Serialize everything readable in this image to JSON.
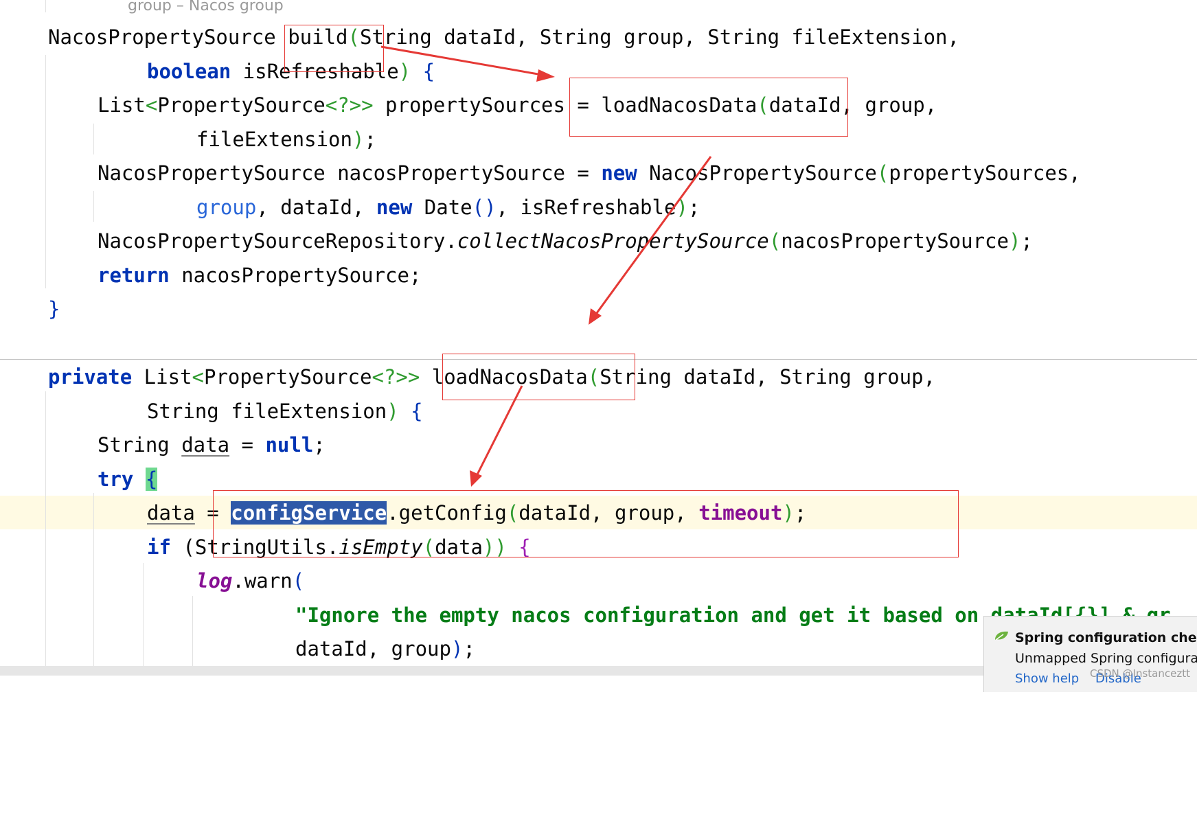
{
  "editor": {
    "hint": "group – Nacos group",
    "m1": {
      "l1a": "NacosPropertySource ",
      "l1b": "build",
      "l1c": "(",
      "l1d": "String dataId, String group, String fileExtension,",
      "l2a": "boolean",
      "l2b": " isRefreshable",
      "l2c": ")",
      "l2d": " {",
      "l3a": "List",
      "l3b": "<",
      "l3c": "PropertySource",
      "l3d": "<?>>",
      "l3e": " propertySources = loadNacosData",
      "l3f": "(",
      "l3g": "dataId, group,",
      "l4a": "fileExtension",
      "l4b": ")",
      "l4c": ";",
      "l5a": "NacosPropertySource nacosPropertySource = ",
      "l5b": "new",
      "l5c": " NacosPropertySource",
      "l5d": "(",
      "l5e": "propertySources,",
      "l6a": "group",
      "l6b": ", dataId, ",
      "l6c": "new",
      "l6d": " Date",
      "l6e": "()",
      "l6f": ", isRefreshable",
      "l6g": ")",
      "l6h": ";",
      "l7a": "NacosPropertySourceRepository.",
      "l7b": "collectNacosPropertySource",
      "l7c": "(",
      "l7d": "nacosPropertySource",
      "l7e": ")",
      "l7f": ";",
      "l8a": "return",
      "l8b": " nacosPropertySource;",
      "l9a": "}"
    },
    "m2": {
      "l1a": "private",
      "l1b": " List",
      "l1c": "<",
      "l1d": "PropertySource",
      "l1e": "<?>>",
      "l1f": " loadNacosData",
      "l1g": "(",
      "l1h": "String dataId, String group,",
      "l2a": "String fileExtension",
      "l2b": ")",
      "l2c": " {",
      "l3a": "String ",
      "l3b": "data",
      "l3c": " = ",
      "l3d": "null",
      "l3e": ";",
      "l4a": "try",
      "l4b": " ",
      "l4c": "{",
      "l5a": "data",
      "l5b": " = ",
      "l5c": "configService",
      "l5d": ".getConfig",
      "l5e": "(",
      "l5f": "dataId, group, ",
      "l5g": "timeout",
      "l5h": ")",
      "l5i": ";",
      "l6a": "if",
      "l6b": " ",
      "l6c": "(",
      "l6d": "StringUtils.",
      "l6e": "isEmpty",
      "l6f": "(",
      "l6g": "data",
      "l6h": "))",
      "l6i": " {",
      "l7a": "log",
      "l7b": ".warn",
      "l7c": "(",
      "l8a": "\"Ignore the empty nacos configuration and get it based on dataId[{}] & gr",
      "l9a": "dataId, group",
      "l9b": ")",
      "l9c": ";"
    }
  },
  "notification": {
    "title": "Spring configuration check",
    "message": "Unmapped Spring configuratio",
    "show_help": "Show help",
    "disable": "Disable",
    "icon": "spring-leaf-icon"
  },
  "watermark": "CSDN @Instanceztt",
  "colors": {
    "annotation": "#e53935",
    "keyword": "#0033b3",
    "string": "#067d17",
    "selection": "#2e59a8",
    "caret_line": "#fffae3"
  }
}
